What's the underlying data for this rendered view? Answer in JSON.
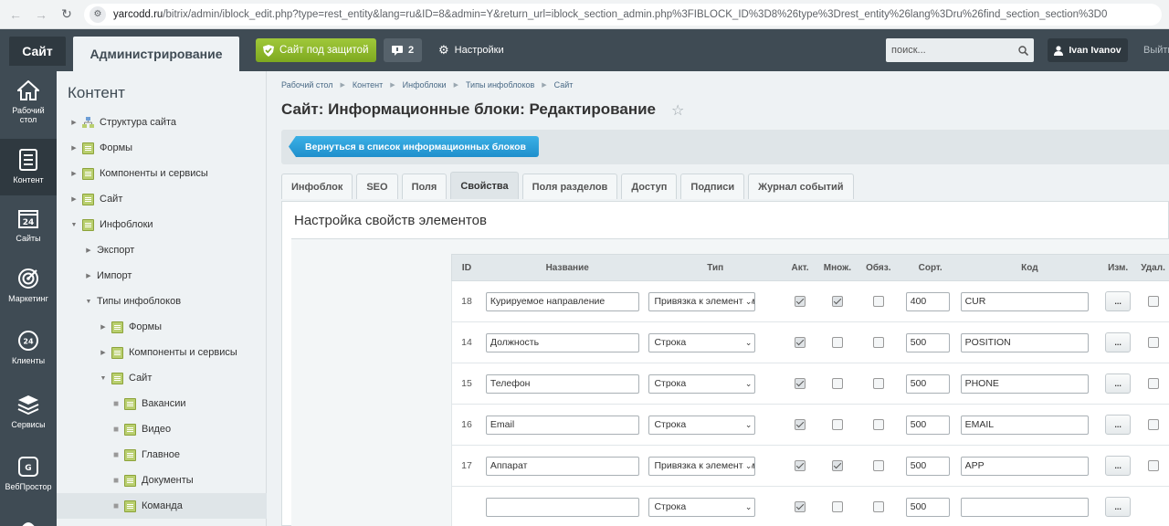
{
  "browser": {
    "url_domain": "yarcodd.ru",
    "url_rest": "/bitrix/admin/iblock_edit.php?type=rest_entity&lang=ru&ID=8&admin=Y&return_url=iblock_section_admin.php%3FIBLOCK_ID%3D8%26type%3Drest_entity%26lang%3Dru%26find_section_section%3D0"
  },
  "top": {
    "site_tab": "Сайт",
    "admin_tab": "Администрирование",
    "secure_label": "Сайт под защитой",
    "notif_count": "2",
    "settings_label": "Настройки",
    "search_placeholder": "поиск...",
    "user_name": "Ivan Ivanov",
    "logout_label": "Выйти"
  },
  "icon_menu": [
    {
      "label_1": "Рабочий",
      "label_2": "стол"
    },
    {
      "label_1": "Контент",
      "label_2": ""
    },
    {
      "label_1": "Сайты",
      "label_2": ""
    },
    {
      "label_1": "Маркетинг",
      "label_2": ""
    },
    {
      "label_1": "Клиенты",
      "label_2": ""
    },
    {
      "label_1": "Сервисы",
      "label_2": ""
    },
    {
      "label_1": "ВебПростор",
      "label_2": ""
    }
  ],
  "tree": {
    "title": "Контент",
    "items": [
      {
        "label": "Структура сайта"
      },
      {
        "label": "Формы"
      },
      {
        "label": "Компоненты и сервисы"
      },
      {
        "label": "Сайт"
      },
      {
        "label": "Инфоблоки"
      },
      {
        "label": "Экспорт"
      },
      {
        "label": "Импорт"
      },
      {
        "label": "Типы инфоблоков"
      },
      {
        "label": "Формы"
      },
      {
        "label": "Компоненты и сервисы"
      },
      {
        "label": "Сайт"
      },
      {
        "label": "Вакансии"
      },
      {
        "label": "Видео"
      },
      {
        "label": "Главное"
      },
      {
        "label": "Документы"
      },
      {
        "label": "Команда"
      }
    ]
  },
  "breadcrumb": [
    "Рабочий стол",
    "Контент",
    "Инфоблоки",
    "Типы инфоблоков",
    "Сайт"
  ],
  "page_title": "Сайт: Информационные блоки: Редактирование",
  "back_button": "Вернуться в список информационных блоков",
  "tabs": [
    "Инфоблок",
    "SEO",
    "Поля",
    "Свойства",
    "Поля разделов",
    "Доступ",
    "Подписи",
    "Журнал событий"
  ],
  "section_title": "Настройка свойств элементов",
  "table": {
    "headers": {
      "id": "ID",
      "name": "Название",
      "type": "Тип",
      "act": "Акт.",
      "mult": "Множ.",
      "req": "Обяз.",
      "sort": "Сорт.",
      "code": "Код",
      "edit": "Изм.",
      "del": "Удал."
    },
    "rows": [
      {
        "id": "18",
        "name": "Курируемое направление",
        "type": "Привязка к элементам",
        "sort": "400",
        "code": "CUR"
      },
      {
        "id": "14",
        "name": "Должность",
        "type": "Строка",
        "sort": "500",
        "code": "POSITION"
      },
      {
        "id": "15",
        "name": "Телефон",
        "type": "Строка",
        "sort": "500",
        "code": "PHONE"
      },
      {
        "id": "16",
        "name": "Email",
        "type": "Строка",
        "sort": "500",
        "code": "EMAIL"
      },
      {
        "id": "17",
        "name": "Аппарат",
        "type": "Привязка к элементам",
        "sort": "500",
        "code": "APP"
      },
      {
        "id": "",
        "name": "",
        "type": "Строка",
        "sort": "500",
        "code": ""
      }
    ],
    "edit_label": "..."
  }
}
